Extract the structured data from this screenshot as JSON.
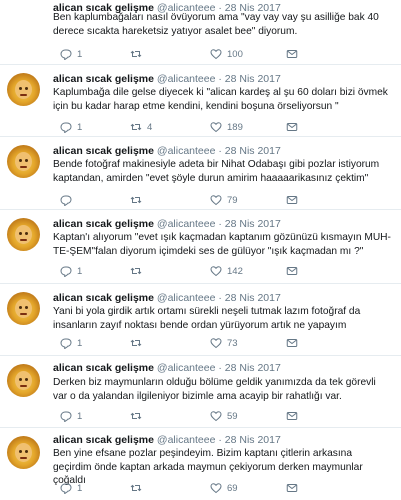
{
  "tweets": [
    {
      "name": "alican sıcak gelişme",
      "handle": "@alicanteee",
      "dot": "·",
      "time": "28 Nis 2017",
      "text": "Ben kaplumbağaları nasıl övüyorum ama \"vay vay vay şu asilliğe bak 40 derece sıcakta hareketsiz yatıyor asalet bee\" diyorum.",
      "replies": "1",
      "retweets": "",
      "likes": "100"
    },
    {
      "name": "alican sıcak gelişme",
      "handle": "@alicanteee",
      "dot": "·",
      "time": "28 Nis 2017",
      "text": "Kaplumbağa dile gelse diyecek ki \"alican kardeş al şu 60 doları bizi övmek için bu kadar harap etme kendini, kendini boşuna örseliyorsun \"",
      "replies": "1",
      "retweets": "4",
      "likes": "189"
    },
    {
      "name": "alican sıcak gelişme",
      "handle": "@alicanteee",
      "dot": "·",
      "time": "28 Nis 2017",
      "text": "Bende fotoğraf makinesiyle adeta bir Nihat Odabaşı gibi pozlar istiyorum kaptandan, amirden \"evet şöyle durun amirim haaaaarikasınız çektim\"",
      "replies": "",
      "retweets": "",
      "likes": "79"
    },
    {
      "name": "alican sıcak gelişme",
      "handle": "@alicanteee",
      "dot": "·",
      "time": "28 Nis 2017",
      "text": "Kaptan'ı alıyorum \"evet ışık kaçmadan kaptanım gözünüzü kısmayın MUH-TE-ŞEM\"falan diyorum içimdeki ses de gülüyor \"ışık kaçmadan mı ?\"",
      "replies": "1",
      "retweets": "",
      "likes": "142"
    },
    {
      "name": "alican sıcak gelişme",
      "handle": "@alicanteee",
      "dot": "·",
      "time": "28 Nis 2017",
      "text": "Yani bi yola girdik artık ortamı sürekli neşeli tutmak lazım fotoğraf da insanların zayıf noktası bende ordan yürüyorum artık ne yapayım",
      "replies": "1",
      "retweets": "",
      "likes": "73"
    },
    {
      "name": "alican sıcak gelişme",
      "handle": "@alicanteee",
      "dot": "·",
      "time": "28 Nis 2017",
      "text": "Derken biz maymunların olduğu bölüme geldik yanımızda da tek görevli var o da yalandan ilgileniyor bizimle ama acayip bir rahatlığı var.",
      "replies": "1",
      "retweets": "",
      "likes": "59"
    },
    {
      "name": "alican sıcak gelişme",
      "handle": "@alicanteee",
      "dot": "·",
      "time": "28 Nis 2017",
      "text": "Ben yine efsane pozlar peşindeyim. Bizim kaptanı çitlerin arkasına geçirdim önde kaptan arkada maymun çekiyorum derken maymunlar çoğaldı",
      "replies": "1",
      "retweets": "",
      "likes": "69"
    }
  ]
}
